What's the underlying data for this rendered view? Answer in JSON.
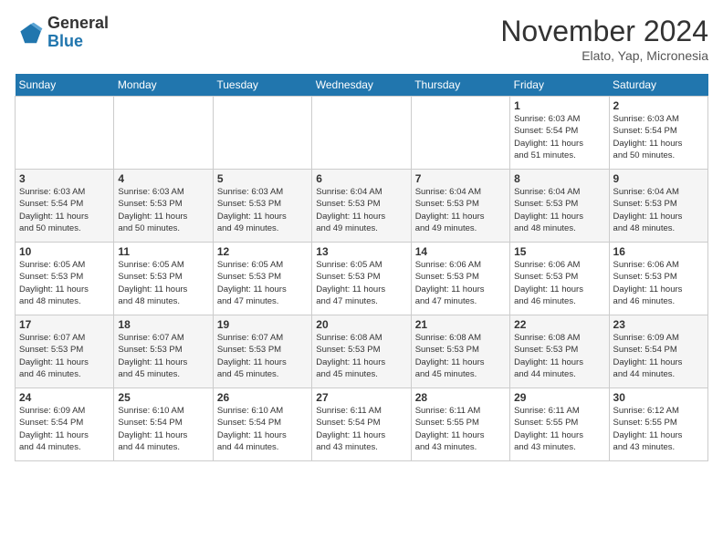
{
  "logo": {
    "general": "General",
    "blue": "Blue"
  },
  "title": "November 2024",
  "subtitle": "Elato, Yap, Micronesia",
  "days_of_week": [
    "Sunday",
    "Monday",
    "Tuesday",
    "Wednesday",
    "Thursday",
    "Friday",
    "Saturday"
  ],
  "weeks": [
    [
      {
        "day": "",
        "info": ""
      },
      {
        "day": "",
        "info": ""
      },
      {
        "day": "",
        "info": ""
      },
      {
        "day": "",
        "info": ""
      },
      {
        "day": "",
        "info": ""
      },
      {
        "day": "1",
        "info": "Sunrise: 6:03 AM\nSunset: 5:54 PM\nDaylight: 11 hours\nand 51 minutes."
      },
      {
        "day": "2",
        "info": "Sunrise: 6:03 AM\nSunset: 5:54 PM\nDaylight: 11 hours\nand 50 minutes."
      }
    ],
    [
      {
        "day": "3",
        "info": "Sunrise: 6:03 AM\nSunset: 5:54 PM\nDaylight: 11 hours\nand 50 minutes."
      },
      {
        "day": "4",
        "info": "Sunrise: 6:03 AM\nSunset: 5:53 PM\nDaylight: 11 hours\nand 50 minutes."
      },
      {
        "day": "5",
        "info": "Sunrise: 6:03 AM\nSunset: 5:53 PM\nDaylight: 11 hours\nand 49 minutes."
      },
      {
        "day": "6",
        "info": "Sunrise: 6:04 AM\nSunset: 5:53 PM\nDaylight: 11 hours\nand 49 minutes."
      },
      {
        "day": "7",
        "info": "Sunrise: 6:04 AM\nSunset: 5:53 PM\nDaylight: 11 hours\nand 49 minutes."
      },
      {
        "day": "8",
        "info": "Sunrise: 6:04 AM\nSunset: 5:53 PM\nDaylight: 11 hours\nand 48 minutes."
      },
      {
        "day": "9",
        "info": "Sunrise: 6:04 AM\nSunset: 5:53 PM\nDaylight: 11 hours\nand 48 minutes."
      }
    ],
    [
      {
        "day": "10",
        "info": "Sunrise: 6:05 AM\nSunset: 5:53 PM\nDaylight: 11 hours\nand 48 minutes."
      },
      {
        "day": "11",
        "info": "Sunrise: 6:05 AM\nSunset: 5:53 PM\nDaylight: 11 hours\nand 48 minutes."
      },
      {
        "day": "12",
        "info": "Sunrise: 6:05 AM\nSunset: 5:53 PM\nDaylight: 11 hours\nand 47 minutes."
      },
      {
        "day": "13",
        "info": "Sunrise: 6:05 AM\nSunset: 5:53 PM\nDaylight: 11 hours\nand 47 minutes."
      },
      {
        "day": "14",
        "info": "Sunrise: 6:06 AM\nSunset: 5:53 PM\nDaylight: 11 hours\nand 47 minutes."
      },
      {
        "day": "15",
        "info": "Sunrise: 6:06 AM\nSunset: 5:53 PM\nDaylight: 11 hours\nand 46 minutes."
      },
      {
        "day": "16",
        "info": "Sunrise: 6:06 AM\nSunset: 5:53 PM\nDaylight: 11 hours\nand 46 minutes."
      }
    ],
    [
      {
        "day": "17",
        "info": "Sunrise: 6:07 AM\nSunset: 5:53 PM\nDaylight: 11 hours\nand 46 minutes."
      },
      {
        "day": "18",
        "info": "Sunrise: 6:07 AM\nSunset: 5:53 PM\nDaylight: 11 hours\nand 45 minutes."
      },
      {
        "day": "19",
        "info": "Sunrise: 6:07 AM\nSunset: 5:53 PM\nDaylight: 11 hours\nand 45 minutes."
      },
      {
        "day": "20",
        "info": "Sunrise: 6:08 AM\nSunset: 5:53 PM\nDaylight: 11 hours\nand 45 minutes."
      },
      {
        "day": "21",
        "info": "Sunrise: 6:08 AM\nSunset: 5:53 PM\nDaylight: 11 hours\nand 45 minutes."
      },
      {
        "day": "22",
        "info": "Sunrise: 6:08 AM\nSunset: 5:53 PM\nDaylight: 11 hours\nand 44 minutes."
      },
      {
        "day": "23",
        "info": "Sunrise: 6:09 AM\nSunset: 5:54 PM\nDaylight: 11 hours\nand 44 minutes."
      }
    ],
    [
      {
        "day": "24",
        "info": "Sunrise: 6:09 AM\nSunset: 5:54 PM\nDaylight: 11 hours\nand 44 minutes."
      },
      {
        "day": "25",
        "info": "Sunrise: 6:10 AM\nSunset: 5:54 PM\nDaylight: 11 hours\nand 44 minutes."
      },
      {
        "day": "26",
        "info": "Sunrise: 6:10 AM\nSunset: 5:54 PM\nDaylight: 11 hours\nand 44 minutes."
      },
      {
        "day": "27",
        "info": "Sunrise: 6:11 AM\nSunset: 5:54 PM\nDaylight: 11 hours\nand 43 minutes."
      },
      {
        "day": "28",
        "info": "Sunrise: 6:11 AM\nSunset: 5:55 PM\nDaylight: 11 hours\nand 43 minutes."
      },
      {
        "day": "29",
        "info": "Sunrise: 6:11 AM\nSunset: 5:55 PM\nDaylight: 11 hours\nand 43 minutes."
      },
      {
        "day": "30",
        "info": "Sunrise: 6:12 AM\nSunset: 5:55 PM\nDaylight: 11 hours\nand 43 minutes."
      }
    ]
  ]
}
